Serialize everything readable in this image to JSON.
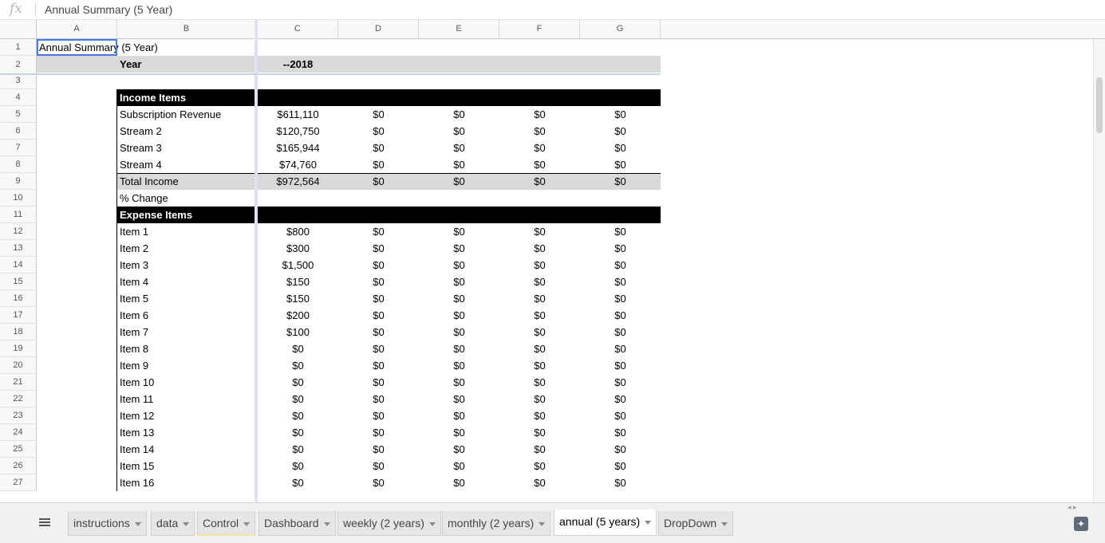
{
  "formula_bar": {
    "icon": "fx",
    "value": "Annual Summary (5 Year)"
  },
  "columns": [
    "A",
    "B",
    "C",
    "D",
    "E",
    "F",
    "G"
  ],
  "rows": [
    "1",
    "2",
    "3",
    "4",
    "5",
    "6",
    "7",
    "8",
    "9",
    "10",
    "11",
    "12",
    "13",
    "14",
    "15",
    "16",
    "17",
    "18",
    "19",
    "20",
    "21",
    "22",
    "23",
    "24",
    "25",
    "26",
    "27"
  ],
  "sheet": {
    "a1": "Annual Summary (5 Year)",
    "year_label": "Year",
    "year_value": "--2018",
    "income_header": "Income Items",
    "income_items": [
      {
        "label": "Subscription Revenue",
        "values": [
          "$611,110",
          "$0",
          "$0",
          "$0",
          "$0"
        ]
      },
      {
        "label": "Stream 2",
        "values": [
          "$120,750",
          "$0",
          "$0",
          "$0",
          "$0"
        ]
      },
      {
        "label": "Stream 3",
        "values": [
          "$165,944",
          "$0",
          "$0",
          "$0",
          "$0"
        ]
      },
      {
        "label": "Stream 4",
        "values": [
          "$74,760",
          "$0",
          "$0",
          "$0",
          "$0"
        ]
      }
    ],
    "total_income": {
      "label": "Total Income",
      "values": [
        "$972,564",
        "$0",
        "$0",
        "$0",
        "$0"
      ]
    },
    "pct_change": "% Change",
    "expense_header": "Expense Items",
    "expense_items": [
      {
        "label": "Item 1",
        "values": [
          "$800",
          "$0",
          "$0",
          "$0",
          "$0"
        ]
      },
      {
        "label": "Item 2",
        "values": [
          "$300",
          "$0",
          "$0",
          "$0",
          "$0"
        ]
      },
      {
        "label": "Item 3",
        "values": [
          "$1,500",
          "$0",
          "$0",
          "$0",
          "$0"
        ]
      },
      {
        "label": "Item 4",
        "values": [
          "$150",
          "$0",
          "$0",
          "$0",
          "$0"
        ]
      },
      {
        "label": "Item 5",
        "values": [
          "$150",
          "$0",
          "$0",
          "$0",
          "$0"
        ]
      },
      {
        "label": "Item 6",
        "values": [
          "$200",
          "$0",
          "$0",
          "$0",
          "$0"
        ]
      },
      {
        "label": "Item 7",
        "values": [
          "$100",
          "$0",
          "$0",
          "$0",
          "$0"
        ]
      },
      {
        "label": "Item 8",
        "values": [
          "$0",
          "$0",
          "$0",
          "$0",
          "$0"
        ]
      },
      {
        "label": "Item 9",
        "values": [
          "$0",
          "$0",
          "$0",
          "$0",
          "$0"
        ]
      },
      {
        "label": "Item 10",
        "values": [
          "$0",
          "$0",
          "$0",
          "$0",
          "$0"
        ]
      },
      {
        "label": "Item 11",
        "values": [
          "$0",
          "$0",
          "$0",
          "$0",
          "$0"
        ]
      },
      {
        "label": "Item 12",
        "values": [
          "$0",
          "$0",
          "$0",
          "$0",
          "$0"
        ]
      },
      {
        "label": "Item 13",
        "values": [
          "$0",
          "$0",
          "$0",
          "$0",
          "$0"
        ]
      },
      {
        "label": "Item 14",
        "values": [
          "$0",
          "$0",
          "$0",
          "$0",
          "$0"
        ]
      },
      {
        "label": "Item 15",
        "values": [
          "$0",
          "$0",
          "$0",
          "$0",
          "$0"
        ]
      },
      {
        "label": "Item 16",
        "values": [
          "$0",
          "$0",
          "$0",
          "$0",
          "$0"
        ]
      }
    ]
  },
  "tabs": [
    {
      "label": "instructions"
    },
    {
      "label": "data"
    },
    {
      "label": "Control"
    },
    {
      "label": "Dashboard"
    },
    {
      "label": "weekly (2 years)"
    },
    {
      "label": "monthly (2 years)"
    },
    {
      "label": "annual (5 years)",
      "active": true
    },
    {
      "label": "DropDown"
    }
  ],
  "colors": {
    "header_black": "#000000",
    "total_grey": "#d9d9d9",
    "selection_blue": "#4a7bdc"
  }
}
